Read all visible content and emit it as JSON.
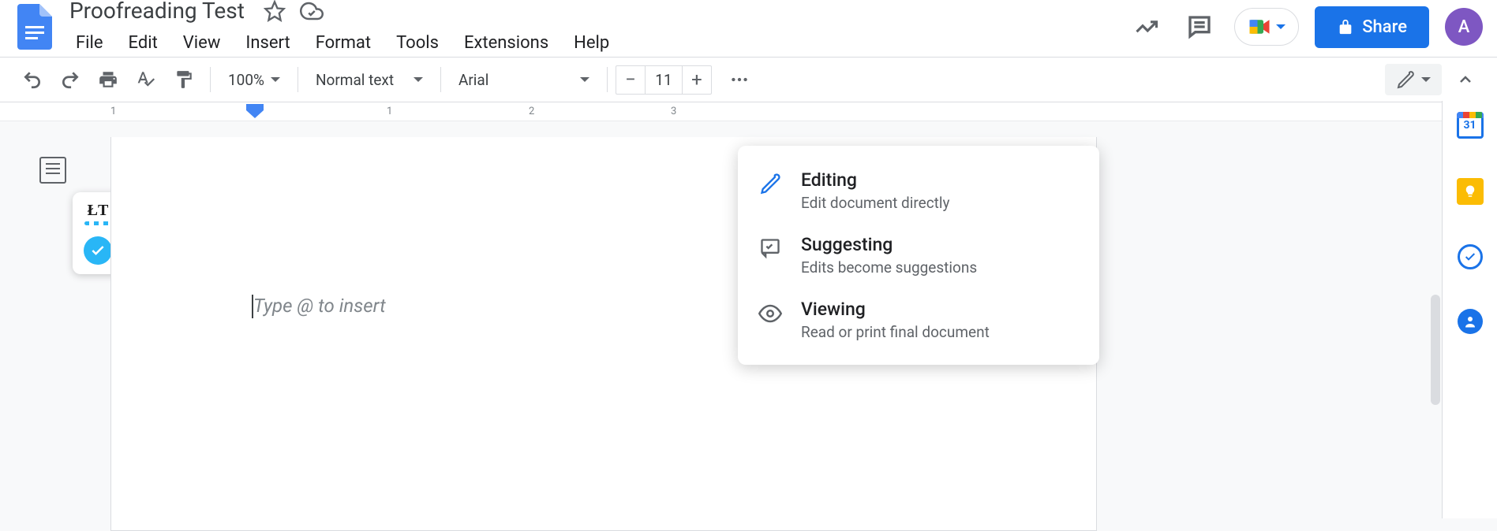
{
  "header": {
    "title": "Proofreading Test",
    "menu": [
      "File",
      "Edit",
      "View",
      "Insert",
      "Format",
      "Tools",
      "Extensions",
      "Help"
    ],
    "share_label": "Share",
    "avatar_initial": "A"
  },
  "toolbar": {
    "zoom": "100%",
    "style": "Normal text",
    "font": "Arial",
    "font_size": "11"
  },
  "ruler": {
    "marks": [
      "1",
      "1",
      "2",
      "3"
    ]
  },
  "document": {
    "placeholder": "Type @ to insert"
  },
  "mode_menu": {
    "items": [
      {
        "title": "Editing",
        "desc": "Edit document directly"
      },
      {
        "title": "Suggesting",
        "desc": "Edits become suggestions"
      },
      {
        "title": "Viewing",
        "desc": "Read or print final document"
      }
    ]
  },
  "sidepanel": {
    "calendar_day": "31"
  }
}
